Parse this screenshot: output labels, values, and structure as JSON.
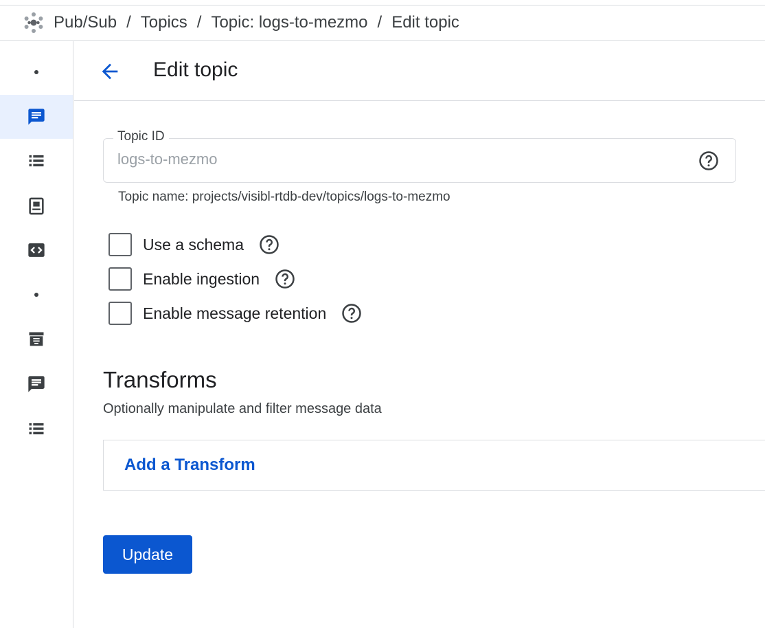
{
  "breadcrumb": {
    "items": [
      "Pub/Sub",
      "Topics",
      "Topic: logs-to-mezmo",
      "Edit topic"
    ],
    "separator": "/"
  },
  "sidebar": {
    "items": [
      {
        "icon": "dot-icon",
        "active": false
      },
      {
        "icon": "topics-icon",
        "active": true
      },
      {
        "icon": "subscriptions-list-icon",
        "active": false
      },
      {
        "icon": "snapshots-icon",
        "active": false
      },
      {
        "icon": "schemas-code-icon",
        "active": false
      },
      {
        "icon": "dot-icon",
        "active": false
      },
      {
        "icon": "lite-reservations-icon",
        "active": false
      },
      {
        "icon": "lite-topics-icon",
        "active": false
      },
      {
        "icon": "lite-subscriptions-icon",
        "active": false
      }
    ]
  },
  "header": {
    "title": "Edit topic"
  },
  "form": {
    "topic_id": {
      "label": "Topic ID",
      "value": "logs-to-mezmo",
      "hint": "Topic name: projects/visibl-rtdb-dev/topics/logs-to-mezmo"
    },
    "checkboxes": [
      {
        "label": "Use a schema",
        "checked": false
      },
      {
        "label": "Enable ingestion",
        "checked": false
      },
      {
        "label": "Enable message retention",
        "checked": false
      }
    ]
  },
  "transforms": {
    "title": "Transforms",
    "subtitle": "Optionally manipulate and filter message data",
    "add_label": "Add a Transform"
  },
  "actions": {
    "update_label": "Update"
  },
  "colors": {
    "accent": "#0b57d0",
    "link": "#0b57d0",
    "active_nav_bg": "#e8f0fe",
    "border": "#dadce0"
  }
}
